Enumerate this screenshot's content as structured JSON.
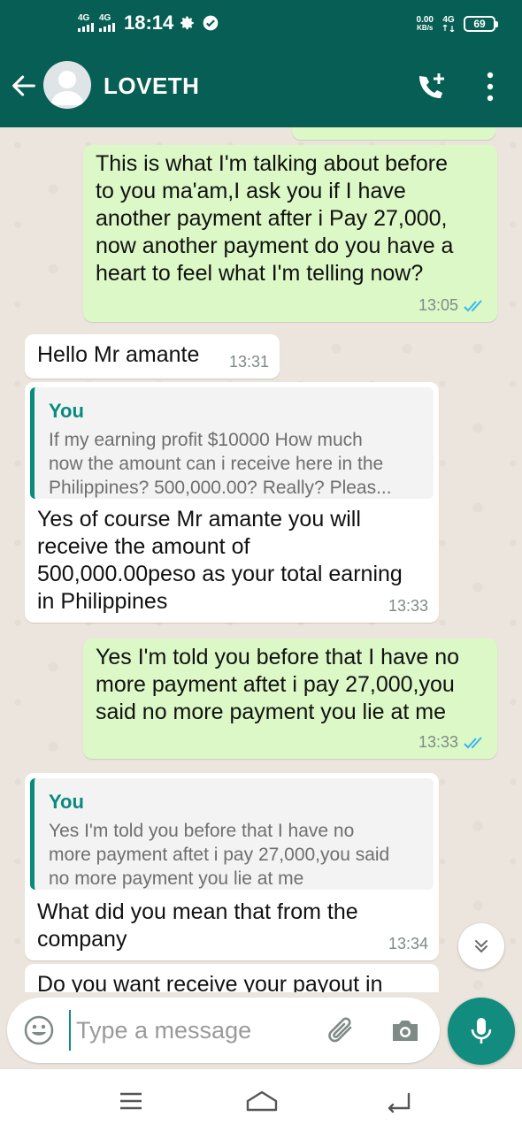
{
  "status_bar": {
    "network_1": "4G",
    "network_2": "4G",
    "time": "18:14",
    "speed_value": "0.00",
    "speed_unit": "KB/s",
    "network_right": "4G",
    "battery": "69"
  },
  "header": {
    "contact_name": "LOVETH",
    "background_color": "#075e54"
  },
  "messages": [
    {
      "direction": "outgoing",
      "lines": [
        "This is what I'm talking about before",
        "to you ma'am,I ask you if I have",
        "another payment after i Pay 27,000,",
        "now another payment do you have a",
        "heart to feel what I'm telling now?"
      ],
      "time": "13:05",
      "status": "read"
    },
    {
      "direction": "incoming",
      "lines": [
        "Hello Mr amante"
      ],
      "time": "13:31"
    },
    {
      "direction": "incoming",
      "quote": {
        "author": "You",
        "lines": [
          "If my earning profit $10000 How much",
          "now the amount can i receive here in the",
          "Philippines? 500,000.00? Really?  Pleas..."
        ]
      },
      "lines": [
        "Yes of course Mr amante you will",
        "receive the amount of",
        "500,000.00peso as your total earning",
        "in Philippines"
      ],
      "time": "13:33"
    },
    {
      "direction": "outgoing",
      "lines": [
        "Yes I'm told you before that I have no",
        "more payment aftet i pay 27,000,you",
        "said no more payment you lie at me"
      ],
      "time": "13:33",
      "status": "read"
    },
    {
      "direction": "incoming",
      "quote": {
        "author": "You",
        "lines": [
          "Yes I'm told you before that I have no",
          "more payment aftet i pay 27,000,you said",
          "no more payment you lie at me"
        ]
      },
      "lines": [
        "What did you mean that from the",
        "company"
      ],
      "time": "13:34"
    },
    {
      "direction": "incoming",
      "lines": [
        "Do you want receive your payout in"
      ],
      "time": ""
    }
  ],
  "composer": {
    "placeholder": "Type a message",
    "value": ""
  },
  "colors": {
    "outgoing_bubble": "#dcf8c6",
    "incoming_bubble": "#ffffff",
    "accent": "#128c7e",
    "read_tick": "#34b7f1"
  },
  "icons": {
    "back": "arrow-left-icon",
    "call": "add-call-icon",
    "menu": "more-vertical-icon",
    "emoji": "emoji-icon",
    "attach": "paperclip-icon",
    "camera": "camera-icon",
    "mic": "microphone-icon",
    "scroll": "double-chevron-down-icon"
  }
}
